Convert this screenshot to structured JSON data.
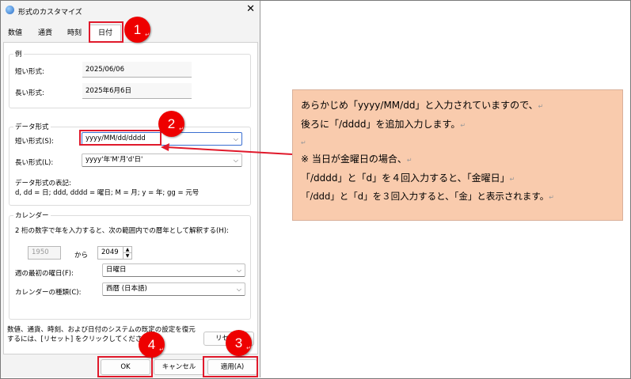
{
  "dialog": {
    "title": "形式のカスタマイズ",
    "close": "✕",
    "tabs": [
      "数値",
      "通貨",
      "時刻",
      "日付"
    ],
    "example": {
      "group_label": "例",
      "short_label": "短い形式:",
      "short_value": "2025/06/06",
      "long_label": "長い形式:",
      "long_value": "2025年6月6日"
    },
    "data_format": {
      "group_label": "データ形式",
      "short_label": "短い形式(S):",
      "short_value": "yyyy/MM/dd/dddd",
      "long_label": "長い形式(L):",
      "long_value": "yyyy'年'M'月'd'日'",
      "notation_title": "データ形式の表記:",
      "notation_text": "d, dd = 日; ddd, dddd = 曜日; M = 月; y = 年; gg = 元号"
    },
    "calendar": {
      "group_label": "カレンダー",
      "description": "2 桁の数字で年を入力すると、次の範囲内での暦年として解釈する(H):",
      "from_year": "1950",
      "to_label": "から",
      "to_year": "2049",
      "first_day_label": "週の最初の曜日(F):",
      "first_day_value": "日曜日",
      "type_label": "カレンダーの種類(C):",
      "type_value": "西暦 (日本語)"
    },
    "reset_text_1": "数値、通貨、時刻、および日付のシステムの既定の設定を復元",
    "reset_text_2": "するには、[リセット] をクリックしてください。",
    "reset_button": "リセット",
    "ok_button": "OK",
    "cancel_button": "キャンセル",
    "apply_button": "適用(A)"
  },
  "badges": [
    "1",
    "2",
    "3",
    "4"
  ],
  "note": {
    "line1": "あらかじめ「yyyy/MM/dd」と入力されていますので、",
    "line2": "後ろに「/dddd」を追加入力します。",
    "line4": "※ 当日が金曜日の場合、",
    "line5": "「/dddd」と「d」を４回入力すると、「金曜日」",
    "line6": "「/ddd」と「d」を３回入力すると、「金」と表示されます。",
    "cr": "↵"
  },
  "colors": {
    "accent_red": "#e0192b",
    "badge_red": "#ee0000",
    "note_bg": "#f9cbad"
  }
}
